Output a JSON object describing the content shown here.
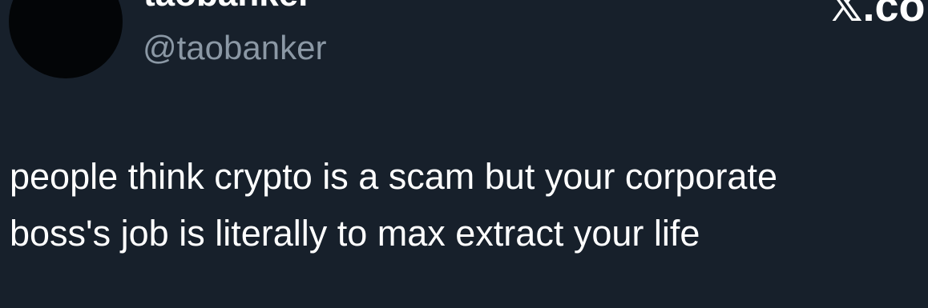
{
  "author": {
    "display_name": "taobanker",
    "handle": "@taobanker"
  },
  "brand": {
    "text": "𝕏.co",
    "icon": "x-logo-icon"
  },
  "tweet": {
    "text": "people think crypto is a scam but your corporate\nboss's job is literally to max extract your life"
  },
  "colors": {
    "background": "#17202b",
    "primary_text": "#ffffff",
    "secondary_text": "#8b98a5",
    "avatar": "#030507"
  }
}
